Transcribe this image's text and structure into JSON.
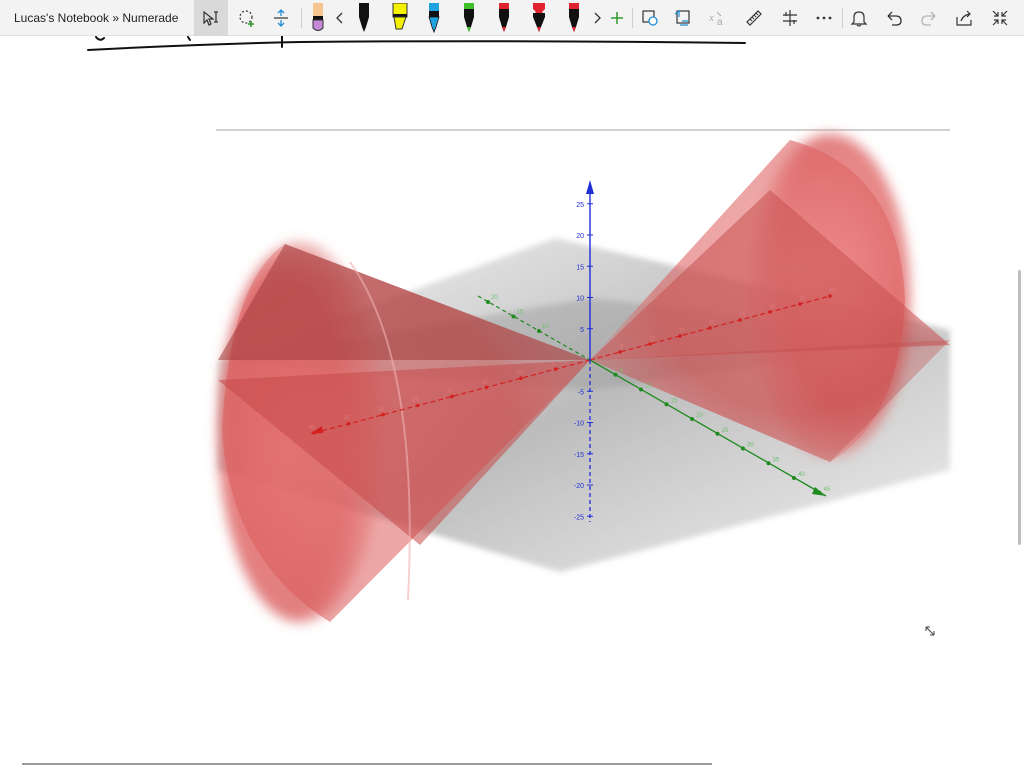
{
  "window": {
    "title": "Lucas's Notebook » Numerade"
  },
  "toolbar": {
    "tools": [
      {
        "name": "select-text-tool-icon",
        "selected": true
      },
      {
        "name": "lasso-select-icon"
      },
      {
        "name": "add-space-icon"
      },
      {
        "name": "eraser-pen-icon",
        "color": "#c58ad6"
      },
      {
        "name": "scroll-left-icon"
      },
      {
        "name": "pen-black-1-icon",
        "color": "#111111"
      },
      {
        "name": "highlighter-yellow-icon",
        "color": "#f5f000"
      },
      {
        "name": "pen-black-2-icon",
        "color": "#111111"
      },
      {
        "name": "pen-cyan-icon",
        "color": "#1fa3e0"
      },
      {
        "name": "pen-green-icon",
        "color": "#3fbf28"
      },
      {
        "name": "pen-red-1-icon",
        "color": "#e0232e"
      },
      {
        "name": "pen-red-2-icon",
        "color": "#e0232e"
      },
      {
        "name": "pen-red-3-icon",
        "color": "#e0232e"
      },
      {
        "name": "scroll-right-icon"
      },
      {
        "name": "add-pen-icon"
      },
      {
        "name": "ink-to-shape-icon"
      },
      {
        "name": "ink-to-text-icon"
      },
      {
        "name": "ink-to-math-icon"
      },
      {
        "name": "ruler-icon"
      },
      {
        "name": "ink-replay-icon"
      },
      {
        "name": "more-icon"
      },
      {
        "name": "notifications-icon"
      },
      {
        "name": "undo-icon"
      },
      {
        "name": "redo-icon"
      },
      {
        "name": "share-icon"
      },
      {
        "name": "full-screen-icon"
      }
    ]
  },
  "graph": {
    "z_ticks": [
      "25",
      "20",
      "15",
      "10",
      "5",
      "-5",
      "-10",
      "-15",
      "-20",
      "-25"
    ],
    "y_ticks_back": [
      "20",
      "15",
      "10"
    ],
    "y_ticks_front": [
      "5",
      "10",
      "15",
      "20",
      "25",
      "30",
      "35",
      "40",
      "45"
    ],
    "x_ticks": [
      "5",
      "10",
      "15",
      "20",
      "25",
      "30",
      "35",
      "40"
    ],
    "axis_colors": {
      "x": "#d42020",
      "y": "#1f8a1f",
      "z": "#1f2fd6"
    }
  }
}
